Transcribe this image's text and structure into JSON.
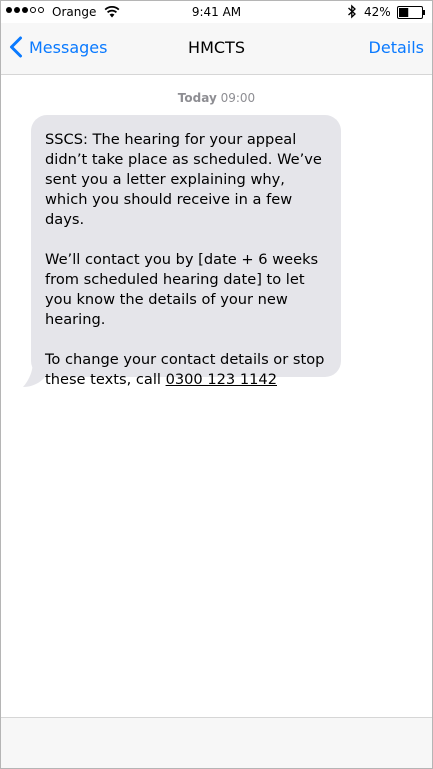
{
  "status_bar": {
    "signal_dots_filled": 3,
    "signal_dots_total": 5,
    "carrier": "Orange",
    "time": "9:41 AM",
    "battery_percent": "42%",
    "battery_level": 0.42
  },
  "nav": {
    "back_label": "Messages",
    "title": "HMCTS",
    "details_label": "Details"
  },
  "conversation": {
    "timestamp_day": "Today",
    "timestamp_time": "09:00",
    "message": {
      "paragraph_1": "SSCS: The hearing for your appeal didn’t take place as scheduled. We’ve sent you a letter explaining why, which you should receive in a few days.",
      "paragraph_2": "We’ll contact you by [date + 6 weeks from scheduled hearing date] to let you know the details of your new hearing.",
      "paragraph_3_prefix": "To change your contact details or stop these texts, call",
      "phone_number": "0300 123 1142"
    }
  },
  "colors": {
    "accent": "#0a7aff",
    "bubble": "#e5e5ea",
    "bar_background": "#f7f7f7",
    "timestamp": "#8e8e93"
  },
  "icons": {
    "wifi": "wifi-icon",
    "bluetooth": "bluetooth-icon",
    "battery": "battery-icon",
    "back": "chevron-left-icon"
  }
}
